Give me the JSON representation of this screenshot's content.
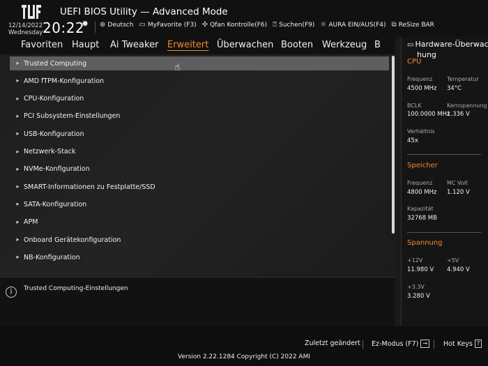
{
  "header": {
    "title": "UEFI BIOS Utility — Advanced Mode",
    "date": "12/14/2022",
    "weekday": "Wednesday",
    "time": "20:22",
    "toolbar": [
      {
        "icon": "globe-icon",
        "label": "Deutsch"
      },
      {
        "icon": "favorite-icon",
        "label": "MyFavorite (F3)"
      },
      {
        "icon": "fan-icon",
        "label": "Qfan Kontrolle(F6)"
      },
      {
        "icon": "help-search-icon",
        "label": "Suchen(F9)"
      },
      {
        "icon": "aura-icon",
        "label": "AURA EIN/AUS(F4)"
      },
      {
        "icon": "resize-bar-icon",
        "label": "ReSize BAR"
      }
    ]
  },
  "tabs": [
    "Favoriten",
    "Haupt",
    "Ai Tweaker",
    "Erweitert",
    "Überwachen",
    "Booten",
    "Werkzeug",
    "B"
  ],
  "active_tab": "Erweitert",
  "menu": [
    "Trusted Computing",
    "AMD fTPM-Konfiguration",
    "CPU-Konfiguration",
    "PCI Subsystem-Einstellungen",
    "USB-Konfiguration",
    "Netzwerk-Stack",
    "NVMe-Konfiguration",
    "SMART-Informationen zu Festplatte/SSD",
    "SATA-Konfiguration",
    "APM",
    "Onboard Gerätekonfiguration",
    "NB-Konfiguration"
  ],
  "selected_item": "Trusted Computing",
  "help_text": "Trusted Computing-Einstellungen",
  "hw_monitor": {
    "title_line1": "Hardware-Überwac",
    "title_line2": "hung",
    "cpu": {
      "heading": "CPU",
      "freq_label": "Frequenz",
      "freq_value": "4500 MHz",
      "temp_label": "Temperatur",
      "temp_value": "34°C",
      "bclk_label": "BCLK",
      "bclk_value": "100.0000 MHz",
      "vcore_label": "Kernspannung",
      "vcore_value": "1.336 V",
      "ratio_label": "Verhältnis",
      "ratio_value": "45x"
    },
    "memory": {
      "heading": "Speicher",
      "freq_label": "Frequenz",
      "freq_value": "4800 MHz",
      "volt_label": "MC Volt",
      "volt_value": "1.120 V",
      "cap_label": "Kapazität",
      "cap_value": "32768 MB"
    },
    "voltage": {
      "heading": "Spannung",
      "v12_label": "+12V",
      "v12_value": "11.980 V",
      "v5_label": "+5V",
      "v5_value": "4.940 V",
      "v33_label": "+3.3V",
      "v33_value": "3.280 V"
    }
  },
  "footer": {
    "last_modified": "Zuletzt geändert",
    "ez_mode": "Ez-Modus (F7)",
    "ez_key": "→",
    "hot_keys": "Hot Keys",
    "hot_key_glyph": "?",
    "version": "Version 2.22.1284 Copyright (C) 2022 AMI"
  },
  "colors": {
    "accent": "#f08c2a",
    "selected_row": "#5e5e5e",
    "background": "#1a1a1a"
  }
}
